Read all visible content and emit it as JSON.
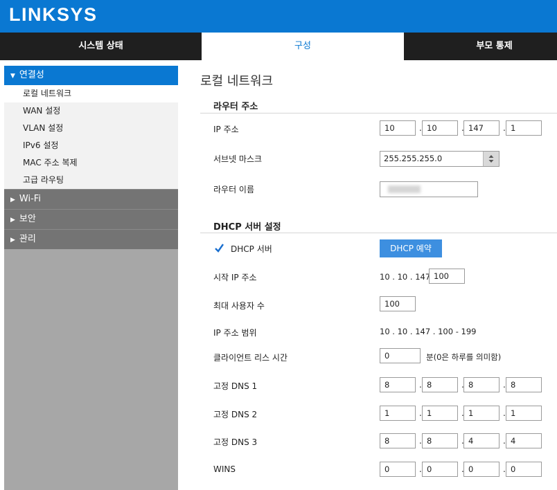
{
  "brand": {
    "logo": "LINKSYS"
  },
  "tabs": [
    "시스템 상태",
    "구성",
    "부모 통제"
  ],
  "sidebar": {
    "section": "연결성",
    "items": [
      "로컬 네트워크",
      "WAN 설정",
      "VLAN 설정",
      "IPv6 설정",
      "MAC 주소 복제",
      "고급 라우팅"
    ],
    "groups": [
      "Wi-Fi",
      "보안",
      "관리"
    ]
  },
  "page": {
    "title": "로컬 네트워크"
  },
  "router": {
    "section": "라우터 주소",
    "ip_label": "IP 주소",
    "ip": [
      "10",
      "10",
      "147",
      "1"
    ],
    "subnet_label": "서브넷 마스크",
    "subnet_value": "255.255.255.0",
    "name_label": "라우터 이름"
  },
  "dhcp": {
    "section": "DHCP 서버 설정",
    "server_label": "DHCP 서버",
    "server_enabled": true,
    "reservation_button": "DHCP 예약",
    "start_label": "시작 IP 주소",
    "start_prefix": "10 . 10 . 147 .",
    "start_value": "100",
    "max_users_label": "최대 사용자 수",
    "max_users_value": "100",
    "range_label": "IP 주소 범위",
    "range_value": "10 . 10 . 147 . 100 - 199",
    "lease_label": "클라이언트 리스 시간",
    "lease_value": "0",
    "lease_unit": "분(0은 하루를 의미함)",
    "dns1_label": "고정 DNS 1",
    "dns1": [
      "8",
      "8",
      "8",
      "8"
    ],
    "dns2_label": "고정 DNS 2",
    "dns2": [
      "1",
      "1",
      "1",
      "1"
    ],
    "dns3_label": "고정 DNS 3",
    "dns3": [
      "8",
      "8",
      "4",
      "4"
    ],
    "wins_label": "WINS",
    "wins": [
      "0",
      "0",
      "0",
      "0"
    ]
  },
  "colors": {
    "brand_blue": "#0a78d2",
    "button_blue": "#3d8fe0",
    "tab_bar": "#1f1f1f"
  }
}
